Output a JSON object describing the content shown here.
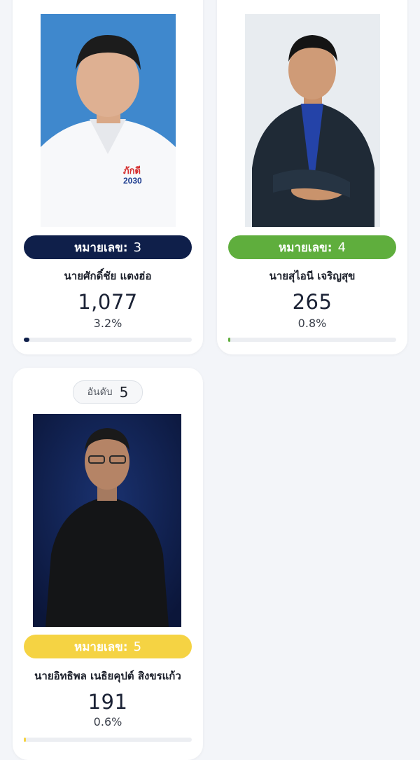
{
  "candidates": [
    {
      "badge_label": "หมายเลข:",
      "number": "3",
      "name": "นายศักดิ์ชัย แตงฮ่อ",
      "votes": "1,077",
      "percent_text": "3.2%",
      "percent": 3.2,
      "color": "#0f1f4a",
      "shirt_logo_top": "ภักดี",
      "shirt_logo_bottom": "2030"
    },
    {
      "badge_label": "หมายเลข:",
      "number": "4",
      "name": "นายสุไอนี เจริญสุข",
      "votes": "265",
      "percent_text": "0.8%",
      "percent": 0.8,
      "color": "#5fae3d"
    },
    {
      "rank_label": "อันดับ",
      "rank": "5",
      "badge_label": "หมายเลข:",
      "number": "5",
      "name": "นายอิทธิพล เนธิยคุปต์ สิงขรแก้ว",
      "votes": "191",
      "percent_text": "0.6%",
      "percent": 0.6,
      "color": "#f5d343"
    }
  ]
}
